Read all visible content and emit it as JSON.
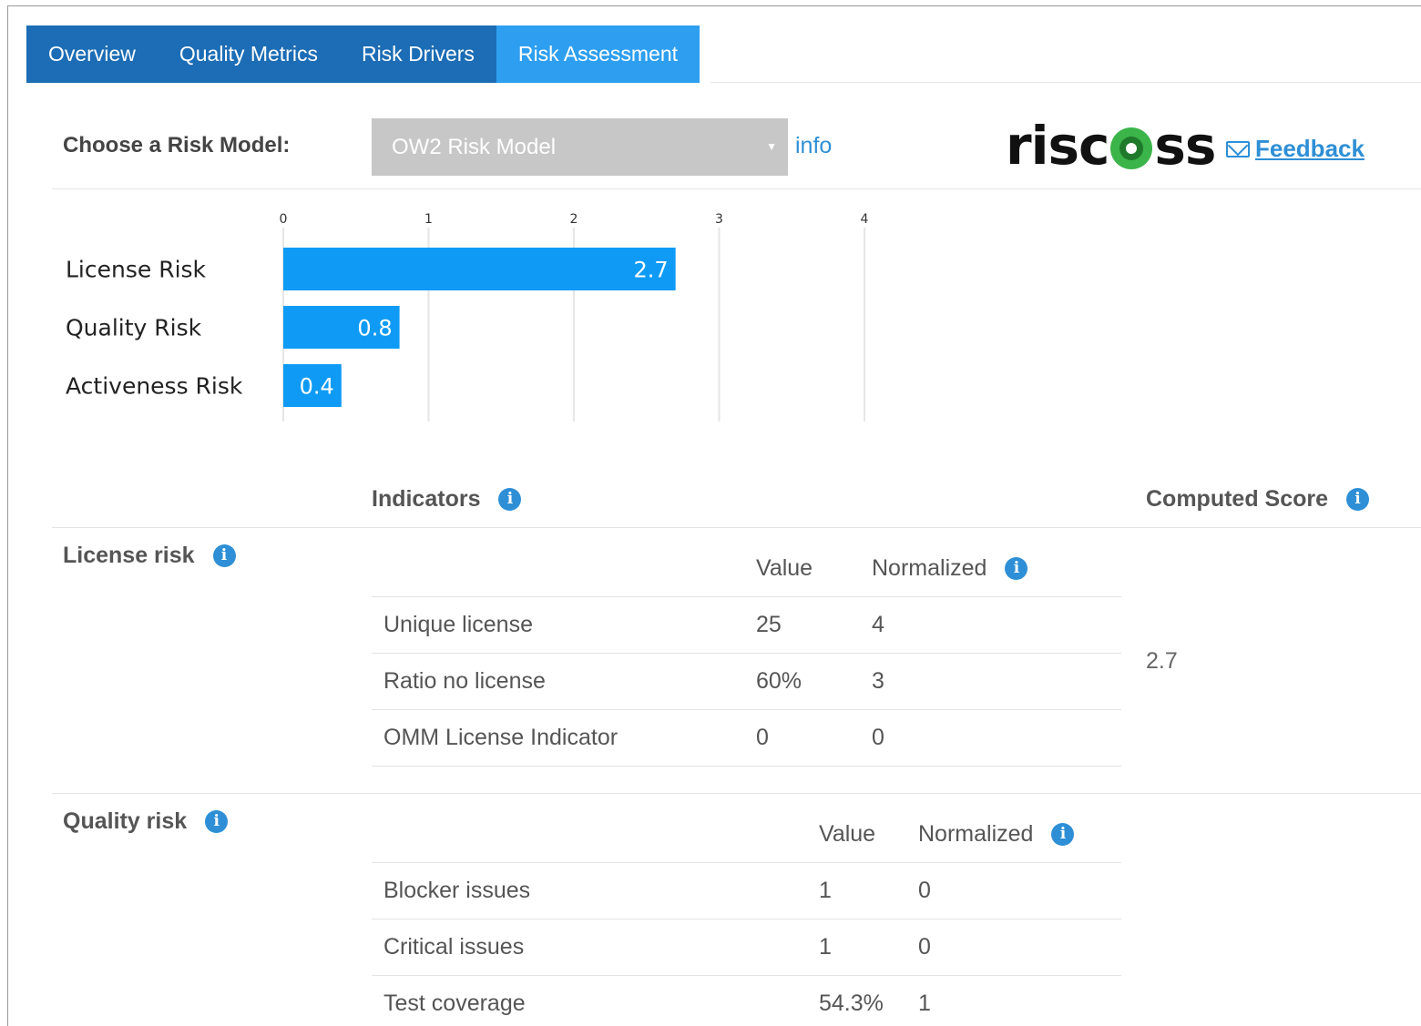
{
  "tabs": [
    {
      "label": "Overview",
      "active": false
    },
    {
      "label": "Quality Metrics",
      "active": false
    },
    {
      "label": "Risk Drivers",
      "active": false
    },
    {
      "label": "Risk Assessment",
      "active": true
    }
  ],
  "model": {
    "label": "Choose a Risk Model:",
    "selected": "OW2 Risk Model",
    "info_link": "info"
  },
  "brand": {
    "logo_left": "risc",
    "logo_right": "ss",
    "feedback_label": "Feedback"
  },
  "chart_data": {
    "type": "bar",
    "orientation": "horizontal",
    "categories": [
      "License Risk",
      "Quality Risk",
      "Activeness Risk"
    ],
    "values": [
      2.7,
      0.8,
      0.4
    ],
    "x_ticks": [
      "0",
      "1",
      "2",
      "3",
      "4"
    ],
    "xlim": [
      0,
      4
    ],
    "bar_color": "#0f9bf5",
    "grid": true
  },
  "indicators_header": "Indicators",
  "computed_score_header": "Computed Score",
  "sections": [
    {
      "name": "License risk",
      "value_header": "Value",
      "normalized_header": "Normalized",
      "rows": [
        {
          "indicator": "Unique license",
          "value": "25",
          "normalized": "4"
        },
        {
          "indicator": "Ratio no license",
          "value": "60%",
          "normalized": "3"
        },
        {
          "indicator": "OMM License Indicator",
          "value": "0",
          "normalized": "0"
        }
      ],
      "score": "2.7"
    },
    {
      "name": "Quality risk",
      "value_header": "Value",
      "normalized_header": "Normalized",
      "rows": [
        {
          "indicator": "Blocker issues",
          "value": "1",
          "normalized": "0"
        },
        {
          "indicator": "Critical issues",
          "value": "1",
          "normalized": "0"
        },
        {
          "indicator": "Test coverage",
          "value": "54.3%",
          "normalized": "1"
        }
      ]
    }
  ],
  "colors": {
    "tab": "#1c6db5",
    "tab_active": "#2e9ff0",
    "link": "#2e8fd6",
    "info_icon": "#2e8fd6",
    "logo_green": "#3bb449"
  }
}
